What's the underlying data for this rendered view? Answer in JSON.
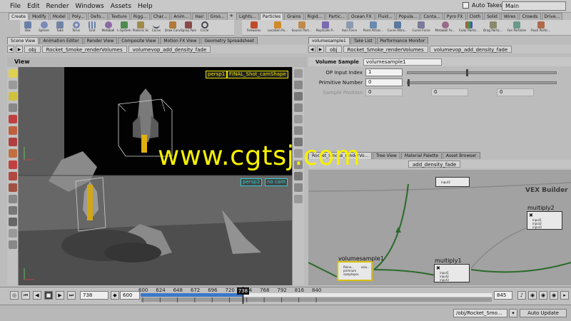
{
  "menubar": {
    "items": [
      "File",
      "Edit",
      "Render",
      "Windows",
      "Assets",
      "Help"
    ],
    "auto_takes": "Auto Takes",
    "desktop": "Main"
  },
  "shelf_left": {
    "tabs": [
      "Create",
      "Modify",
      "Model",
      "Poly...",
      "Defo...",
      "Texture",
      "Rigg...",
      "Char...",
      "Anim...",
      "Hair",
      "Groo..."
    ],
    "tools": [
      "Box",
      "Sphere",
      "Tube",
      "Torus",
      "Grid",
      "Metaball",
      "L-System",
      "Platonic Sol...",
      "Curve",
      "Draw Curve",
      "Spray Paint",
      "Circle"
    ]
  },
  "shelf_right": {
    "tabs": [
      "Lights...",
      "Particles",
      "Grains",
      "Rigid...",
      "Partic...",
      "Ocean FX",
      "Fluid...",
      "Popula...",
      "Conta...",
      "Pyro FX",
      "Cloth",
      "Solid",
      "Wires",
      "Crowds",
      "Drive..."
    ],
    "tools": [
      "Fireworks",
      "Location Pa...",
      "Source Part...",
      "Replicate P...",
      "Axis Force",
      "Point Attrac...",
      "Curve Attra...",
      "Curve Force",
      "Metaball Fo...",
      "Color Partic...",
      "Drag Partic...",
      "Fan Particles",
      "Flock Partic..."
    ]
  },
  "left_pane": {
    "tabs": [
      "Scene View",
      "Animation Editor",
      "Render View",
      "Composite View",
      "Motion FX View",
      "Geometry Spreadsheet"
    ],
    "path": [
      "obj",
      "Rocket_Smoke_renderVolumes",
      "volumevop_add_density_fade"
    ],
    "view_title": "View",
    "cam1": "persp1",
    "cam1_shape": "FINAL_Shot_camShape",
    "cam2": "persp2",
    "cam2_shape": "no cam"
  },
  "right_pane": {
    "tabs": [
      "volumesample1",
      "Take List",
      "Performance Monitor"
    ],
    "path": [
      "obj",
      "Rocket_Smoke_renderVolumes",
      "volumevop_add_density_fade"
    ],
    "node_type": "Volume Sample",
    "node_name": "volumesample1",
    "params": [
      {
        "label": "OP Input Index",
        "value": "1",
        "slider": 0.4
      },
      {
        "label": "Primitive Number",
        "value": "0",
        "slider": 0.0
      },
      {
        "label": "Sample Position",
        "value": "0",
        "extra": [
          "0",
          "0"
        ]
      }
    ]
  },
  "network": {
    "tabs": [
      "Rocket_Smoke_renderVo...",
      "Tree View",
      "Material Palette",
      "Asset Browser"
    ],
    "path_tail": "add_density_fade",
    "context": "VEX Builder",
    "nodes": [
      {
        "name": "volumesample1",
        "ports": [
          "filena...",
          "primnum",
          "samplepos"
        ],
        "out": "volu..."
      },
      {
        "name": "multiply1",
        "ports": [
          "input1",
          "input2",
          "input3"
        ],
        "out": "prod"
      },
      {
        "name": "multiply2",
        "ports": [
          "input1",
          "input2",
          "input3"
        ],
        "out": "prod"
      }
    ],
    "top_port": "input3"
  },
  "timeline": {
    "current_frame": "738",
    "start_frame": "600",
    "end_frame": "845",
    "ticks": [
      "600",
      "624",
      "648",
      "672",
      "696",
      "720",
      "744",
      "768",
      "792",
      "816",
      "840"
    ],
    "marker": "738"
  },
  "statusbar": {
    "path": "/obj/Rocket_Smo...",
    "update_mode": "Auto Update"
  },
  "watermark": "www.cgtsj.com"
}
